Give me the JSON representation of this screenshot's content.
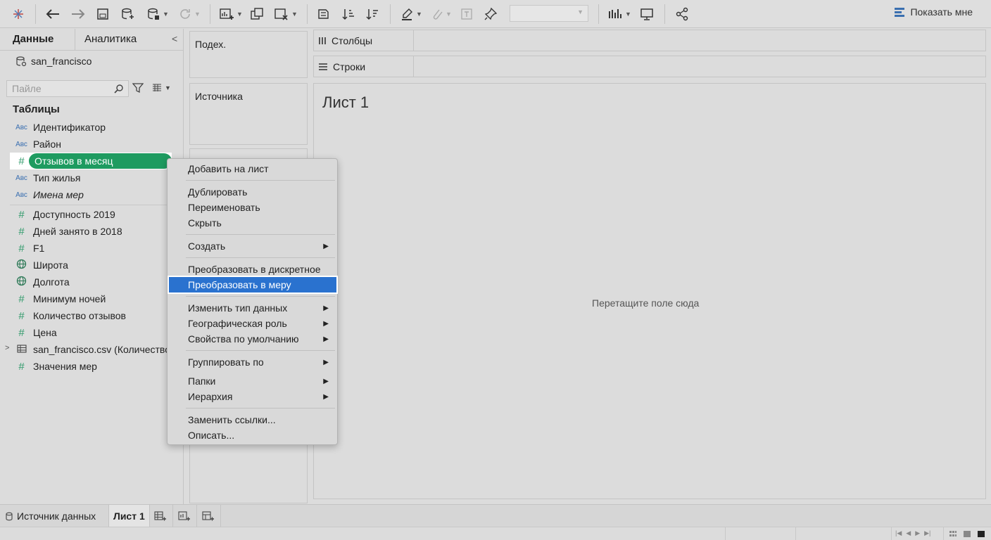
{
  "toolbar": {
    "show_me_label": "Показать мне"
  },
  "data_pane": {
    "tab_data": "Данные",
    "tab_analytics": "Аналитика",
    "data_source": "san_francisco",
    "search_placeholder": "Пайле",
    "section_title": "Таблицы",
    "field_type_abc": "Авс",
    "field_type_num": "#",
    "fields": [
      {
        "type": "abc",
        "name": "Идентификатор"
      },
      {
        "type": "abc",
        "name": "Район"
      },
      {
        "type": "num",
        "name": "Отзывов в месяц",
        "selected": true
      },
      {
        "type": "abc",
        "name": "Тип жилья"
      },
      {
        "type": "abc",
        "name": "Имена мер",
        "italic": true
      },
      {
        "type": "num",
        "name": "Доступность 2019"
      },
      {
        "type": "num",
        "name": "Дней занято в 2018"
      },
      {
        "type": "num",
        "name": "F1"
      },
      {
        "type": "geo",
        "name": "Широта"
      },
      {
        "type": "geo",
        "name": "Долгота"
      },
      {
        "type": "num",
        "name": "Минимум ночей"
      },
      {
        "type": "num",
        "name": "Количество отзывов"
      },
      {
        "type": "num",
        "name": "Цена"
      },
      {
        "type": "table",
        "name": "san_francisco.csv (Количество)"
      },
      {
        "type": "num",
        "name": "Значения мер"
      }
    ]
  },
  "cards": {
    "pages": "Подех.",
    "filters": "Источника"
  },
  "shelves": {
    "columns": "Столбцы",
    "rows": "Строки"
  },
  "view": {
    "sheet_title": "Лист 1",
    "drop_hint": "Перетащите поле сюда"
  },
  "context_menu": {
    "items": [
      "Добавить на лист",
      "Дублировать",
      "Переименовать",
      "Скрыть",
      "Создать",
      "Преобразовать в дискретное",
      "Преобразовать в меру",
      "Изменить тип данных",
      "Географическая роль",
      "Свойства по умолчанию",
      "Группировать по",
      "Папки",
      "Иерархия",
      "Заменить ссылки...",
      "Описать..."
    ],
    "highlighted": "Преобразовать в меру"
  },
  "bottom_tabs": {
    "data_source": "Источник данных",
    "sheet": "Лист 1"
  },
  "colors": {
    "accent_green": "#1e9b60",
    "highlight_blue": "#2a72cf"
  }
}
